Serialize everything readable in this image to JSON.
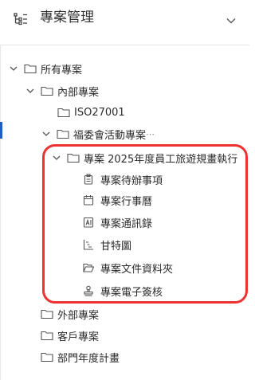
{
  "header": {
    "title": "專案管理"
  },
  "tree": {
    "all_projects": "所有專案",
    "internal": "內部專案",
    "iso": "ISO27001",
    "welfare": "福委會活動專案",
    "welfare_suffix": "⋯",
    "project_2025": "專案 2025年度員工旅遊規畫執行",
    "items": [
      {
        "label": "專案待辦事項",
        "icon": "clipboard-icon"
      },
      {
        "label": "專案行事曆",
        "icon": "calendar-icon"
      },
      {
        "label": "專案通訊錄",
        "icon": "contact-card-icon"
      },
      {
        "label": "甘特圖",
        "icon": "gantt-chart-icon"
      },
      {
        "label": "專案文件資料夾",
        "icon": "folder-open-icon"
      },
      {
        "label": "專案電子簽核",
        "icon": "stamp-icon"
      }
    ],
    "external": "外部專案",
    "client": "客戶專案",
    "department": "部門年度計畫"
  },
  "colors": {
    "highlight": "#ee3131",
    "selection_marker": "#1b5fbf"
  }
}
